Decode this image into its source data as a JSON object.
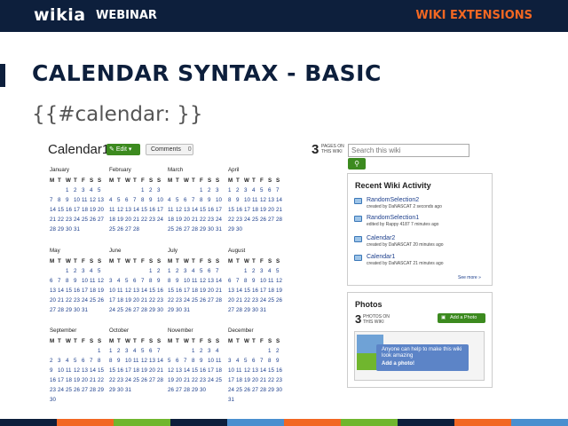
{
  "header": {
    "logo": "wikia",
    "webinar": "WEBINAR",
    "section": "WIKI EXTENSIONS"
  },
  "slide": {
    "title": "CALENDAR SYNTAX - BASIC",
    "subtitle": "{{#calendar: }}"
  },
  "wiki": {
    "page_title": "Calendar1",
    "edit_label": "Edit",
    "comments_label": "Comments",
    "comments_count": "0",
    "pages_count": "3",
    "pages_label": "PAGES ON THIS WIKI",
    "search_placeholder": "Search this wiki"
  },
  "calendar": {
    "dow": [
      "M",
      "T",
      "W",
      "T",
      "F",
      "S",
      "S"
    ],
    "months": [
      {
        "name": "January",
        "weeks": [
          [
            "",
            "",
            "1",
            "2",
            "3",
            "4",
            "5"
          ],
          [
            "7",
            "8",
            "9",
            "10",
            "11",
            "12",
            "13"
          ],
          [
            "14",
            "15",
            "16",
            "17",
            "18",
            "19",
            "20"
          ],
          [
            "21",
            "22",
            "23",
            "24",
            "25",
            "26",
            "27"
          ],
          [
            "28",
            "29",
            "30",
            "31",
            "",
            "",
            ""
          ]
        ]
      },
      {
        "name": "February",
        "weeks": [
          [
            "",
            "",
            "",
            "",
            "1",
            "2",
            "3"
          ],
          [
            "4",
            "5",
            "6",
            "7",
            "8",
            "9",
            "10"
          ],
          [
            "11",
            "12",
            "13",
            "14",
            "15",
            "16",
            "17"
          ],
          [
            "18",
            "19",
            "20",
            "21",
            "22",
            "23",
            "24"
          ],
          [
            "25",
            "26",
            "27",
            "28",
            "",
            "",
            ""
          ]
        ]
      },
      {
        "name": "March",
        "weeks": [
          [
            "",
            "",
            "",
            "",
            "1",
            "2",
            "3"
          ],
          [
            "4",
            "5",
            "6",
            "7",
            "8",
            "9",
            "10"
          ],
          [
            "11",
            "12",
            "13",
            "14",
            "15",
            "16",
            "17"
          ],
          [
            "18",
            "19",
            "20",
            "21",
            "22",
            "23",
            "24"
          ],
          [
            "25",
            "26",
            "27",
            "28",
            "29",
            "30",
            "31"
          ]
        ]
      },
      {
        "name": "April",
        "weeks": [
          [
            "1",
            "2",
            "3",
            "4",
            "5",
            "6",
            "7"
          ],
          [
            "8",
            "9",
            "10",
            "11",
            "12",
            "13",
            "14"
          ],
          [
            "15",
            "16",
            "17",
            "18",
            "19",
            "20",
            "21"
          ],
          [
            "22",
            "23",
            "24",
            "25",
            "26",
            "27",
            "28"
          ],
          [
            "29",
            "30",
            "",
            "",
            "",
            "",
            ""
          ]
        ]
      },
      {
        "name": "May",
        "weeks": [
          [
            "",
            "",
            "1",
            "2",
            "3",
            "4",
            "5"
          ],
          [
            "6",
            "7",
            "8",
            "9",
            "10",
            "11",
            "12"
          ],
          [
            "13",
            "14",
            "15",
            "16",
            "17",
            "18",
            "19"
          ],
          [
            "20",
            "21",
            "22",
            "23",
            "24",
            "25",
            "26"
          ],
          [
            "27",
            "28",
            "29",
            "30",
            "31",
            "",
            ""
          ]
        ]
      },
      {
        "name": "June",
        "weeks": [
          [
            "",
            "",
            "",
            "",
            "",
            "1",
            "2"
          ],
          [
            "3",
            "4",
            "5",
            "6",
            "7",
            "8",
            "9"
          ],
          [
            "10",
            "11",
            "12",
            "13",
            "14",
            "15",
            "16"
          ],
          [
            "17",
            "18",
            "19",
            "20",
            "21",
            "22",
            "23"
          ],
          [
            "24",
            "25",
            "26",
            "27",
            "28",
            "29",
            "30"
          ]
        ]
      },
      {
        "name": "July",
        "weeks": [
          [
            "1",
            "2",
            "3",
            "4",
            "5",
            "6",
            "7"
          ],
          [
            "8",
            "9",
            "10",
            "11",
            "12",
            "13",
            "14"
          ],
          [
            "15",
            "16",
            "17",
            "18",
            "19",
            "20",
            "21"
          ],
          [
            "22",
            "23",
            "24",
            "25",
            "26",
            "27",
            "28"
          ],
          [
            "29",
            "30",
            "31",
            "",
            "",
            "",
            ""
          ]
        ]
      },
      {
        "name": "August",
        "weeks": [
          [
            "",
            "",
            "1",
            "2",
            "3",
            "4",
            "5"
          ],
          [
            "6",
            "7",
            "8",
            "9",
            "10",
            "11",
            "12"
          ],
          [
            "13",
            "14",
            "15",
            "16",
            "17",
            "18",
            "19"
          ],
          [
            "20",
            "21",
            "22",
            "23",
            "24",
            "25",
            "26"
          ],
          [
            "27",
            "28",
            "29",
            "30",
            "31",
            "",
            ""
          ]
        ]
      },
      {
        "name": "September",
        "weeks": [
          [
            "",
            "",
            "",
            "",
            "",
            "",
            "1"
          ],
          [
            "2",
            "3",
            "4",
            "5",
            "6",
            "7",
            "8"
          ],
          [
            "9",
            "10",
            "11",
            "12",
            "13",
            "14",
            "15"
          ],
          [
            "16",
            "17",
            "18",
            "19",
            "20",
            "21",
            "22"
          ],
          [
            "23",
            "24",
            "25",
            "26",
            "27",
            "28",
            "29"
          ],
          [
            "30",
            "",
            "",
            "",
            "",
            "",
            ""
          ]
        ]
      },
      {
        "name": "October",
        "weeks": [
          [
            "1",
            "2",
            "3",
            "4",
            "5",
            "6",
            "7"
          ],
          [
            "8",
            "9",
            "10",
            "11",
            "12",
            "13",
            "14"
          ],
          [
            "15",
            "16",
            "17",
            "18",
            "19",
            "20",
            "21"
          ],
          [
            "22",
            "23",
            "24",
            "25",
            "26",
            "27",
            "28"
          ],
          [
            "29",
            "30",
            "31",
            "",
            "",
            "",
            ""
          ]
        ]
      },
      {
        "name": "November",
        "weeks": [
          [
            "",
            "",
            "",
            "1",
            "2",
            "3",
            "4"
          ],
          [
            "5",
            "6",
            "7",
            "8",
            "9",
            "10",
            "11"
          ],
          [
            "12",
            "13",
            "14",
            "15",
            "16",
            "17",
            "18"
          ],
          [
            "19",
            "20",
            "21",
            "22",
            "23",
            "24",
            "25"
          ],
          [
            "26",
            "27",
            "28",
            "29",
            "30",
            "",
            ""
          ]
        ]
      },
      {
        "name": "December",
        "weeks": [
          [
            "",
            "",
            "",
            "",
            "",
            "1",
            "2"
          ],
          [
            "3",
            "4",
            "5",
            "6",
            "7",
            "8",
            "9"
          ],
          [
            "10",
            "11",
            "12",
            "13",
            "14",
            "15",
            "16"
          ],
          [
            "17",
            "18",
            "19",
            "20",
            "21",
            "22",
            "23"
          ],
          [
            "24",
            "25",
            "26",
            "27",
            "28",
            "29",
            "30"
          ],
          [
            "31",
            "",
            "",
            "",
            "",
            "",
            ""
          ]
        ]
      }
    ]
  },
  "activity": {
    "title": "Recent Wiki Activity",
    "items": [
      {
        "link": "RandomSelection2",
        "meta": "created by DaNASCAT 2 seconds ago"
      },
      {
        "link": "RandomSelection1",
        "meta": "edited by Rappy 4187 7 minutes ago"
      },
      {
        "link": "Calendar2",
        "meta": "created by DaNASCAT 20 minutes ago"
      },
      {
        "link": "Calendar1",
        "meta": "created by DaNASCAT 21 minutes ago"
      }
    ],
    "see_more": "See more »"
  },
  "photos": {
    "title": "Photos",
    "count": "3",
    "count_label": "PHOTOS ON THIS WIKI",
    "add_label": "Add a Photo",
    "tooltip_text": "Anyone can help to make this wiki look amazing",
    "tooltip_cta": "Add a photo!"
  },
  "colors": {
    "navy": "#0d1f3c",
    "accent": "#f26722",
    "green": "#3c8a1f",
    "stripes": [
      "#0d1f3c",
      "#f26722",
      "#70b62e",
      "#0d1f3c",
      "#4a8fcf",
      "#f26722",
      "#70b62e",
      "#0d1f3c",
      "#f26722",
      "#4a8fcf"
    ]
  }
}
